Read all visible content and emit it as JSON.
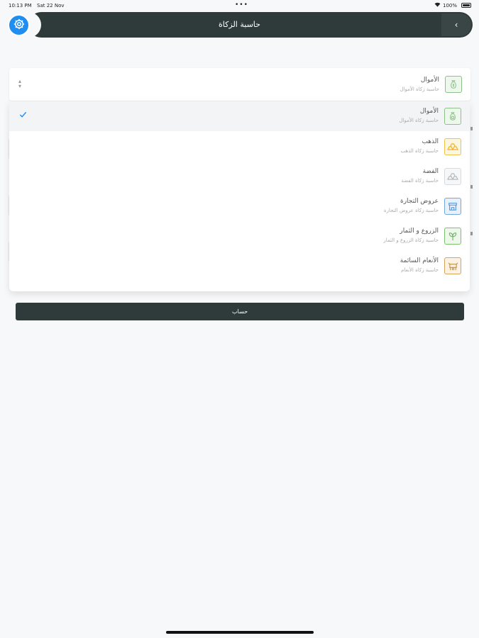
{
  "status_bar": {
    "time": "10:13 PM",
    "date": "Sat 22 Nov",
    "dots": "•••",
    "battery": "100%"
  },
  "header": {
    "title": "حاسبة الزكاة",
    "back_glyph": "‹"
  },
  "select": {
    "selected_title": "الأموال",
    "selected_subtitle": "حاسبة زكاة الأموال"
  },
  "options": [
    {
      "title": "الأموال",
      "subtitle": "حاسبة زكاة الأموال",
      "icon": "money-bag-icon",
      "color": "#8dc08a",
      "selected": true
    },
    {
      "title": "الذهب",
      "subtitle": "حاسبة زكاة الذهب",
      "icon": "gold-bars-icon",
      "color": "#f0c24b",
      "selected": false
    },
    {
      "title": "الفضة",
      "subtitle": "حاسبة زكاة الفضة",
      "icon": "silver-bars-icon",
      "color": "#c9cdd2",
      "selected": false
    },
    {
      "title": "عروض التجارة",
      "subtitle": "حاسبة زكاة عروض التجارة",
      "icon": "store-icon",
      "color": "#6fa8dc",
      "selected": false
    },
    {
      "title": "الزروع و الثمار",
      "subtitle": "حاسبة زكاة الزروع و الثمار",
      "icon": "plant-icon",
      "color": "#7cbf6f",
      "selected": false
    },
    {
      "title": "الأنعام السائمة",
      "subtitle": "حاسبة زكاة الأنعام",
      "icon": "livestock-icon",
      "color": "#d6a45c",
      "selected": false
    }
  ],
  "calculate_label": "حساب",
  "colors": {
    "header": "#2f3b3a",
    "accent": "#1f8ef1",
    "background": "#f7f8fa"
  }
}
